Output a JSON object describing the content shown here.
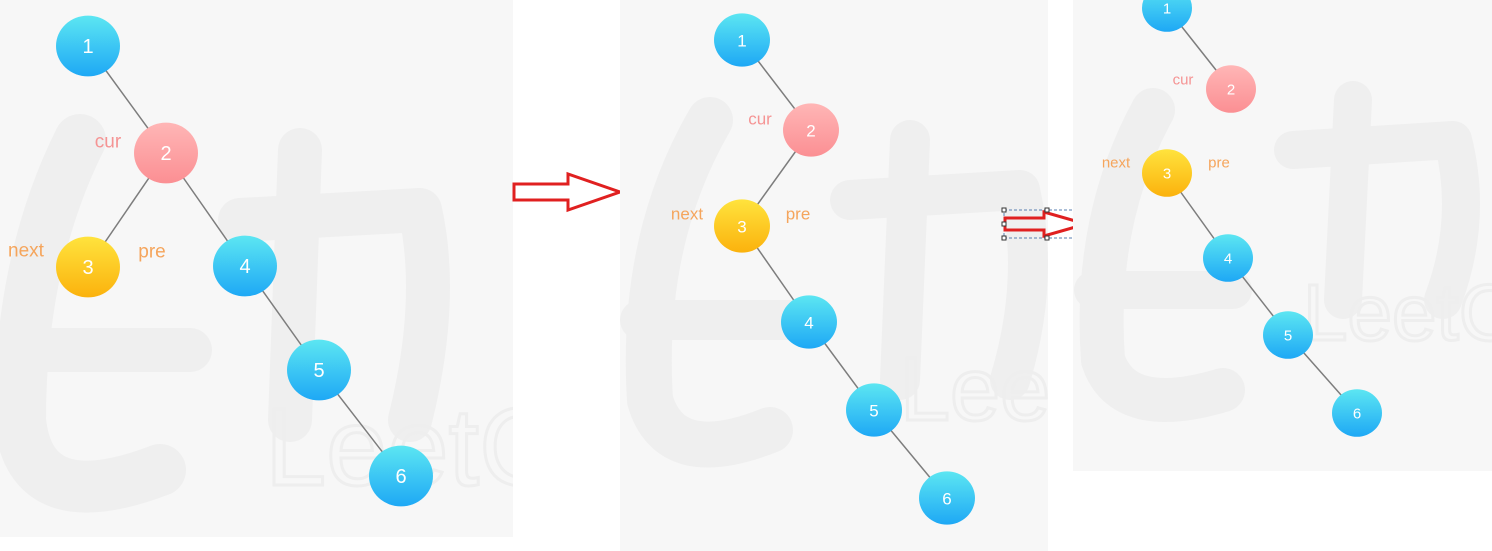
{
  "colors": {
    "blue_top": "#5ce6f2",
    "blue_bottom": "#1ea8f5",
    "pink_top": "#ffb6b6",
    "pink_bottom": "#fb8f93",
    "yellow_top": "#ffe33d",
    "yellow_bottom": "#fbb20d",
    "edge": "#7d7d7d",
    "cur_text": "#f59494",
    "pointer_text": "#f5a55c",
    "arrow": "#e02020"
  },
  "panels": [
    {
      "nodes": [
        {
          "id": "1",
          "label": "1",
          "role": "plain"
        },
        {
          "id": "2",
          "label": "2",
          "role": "cur"
        },
        {
          "id": "3",
          "label": "3",
          "role": "next"
        },
        {
          "id": "4",
          "label": "4",
          "role": "plain"
        },
        {
          "id": "5",
          "label": "5",
          "role": "plain"
        },
        {
          "id": "6",
          "label": "6",
          "role": "plain"
        }
      ],
      "edges": [
        [
          "1",
          "2"
        ],
        [
          "2",
          "3"
        ],
        [
          "2",
          "4"
        ],
        [
          "4",
          "5"
        ],
        [
          "5",
          "6"
        ]
      ],
      "pointers": [
        {
          "text": "cur",
          "node": "2"
        },
        {
          "text": "next",
          "node": "3"
        },
        {
          "text": "pre",
          "node": "3"
        }
      ]
    },
    {
      "nodes": [
        {
          "id": "1",
          "label": "1",
          "role": "plain"
        },
        {
          "id": "2",
          "label": "2",
          "role": "cur"
        },
        {
          "id": "3",
          "label": "3",
          "role": "next"
        },
        {
          "id": "4",
          "label": "4",
          "role": "plain"
        },
        {
          "id": "5",
          "label": "5",
          "role": "plain"
        },
        {
          "id": "6",
          "label": "6",
          "role": "plain"
        }
      ],
      "edges": [
        [
          "1",
          "2"
        ],
        [
          "2",
          "3"
        ],
        [
          "3",
          "4"
        ],
        [
          "4",
          "5"
        ],
        [
          "5",
          "6"
        ]
      ],
      "pointers": [
        {
          "text": "cur",
          "node": "2"
        },
        {
          "text": "next",
          "node": "3"
        },
        {
          "text": "pre",
          "node": "3"
        }
      ]
    },
    {
      "nodes": [
        {
          "id": "1",
          "label": "1",
          "role": "plain"
        },
        {
          "id": "2",
          "label": "2",
          "role": "cur"
        },
        {
          "id": "3",
          "label": "3",
          "role": "next"
        },
        {
          "id": "4",
          "label": "4",
          "role": "plain"
        },
        {
          "id": "5",
          "label": "5",
          "role": "plain"
        },
        {
          "id": "6",
          "label": "6",
          "role": "plain"
        }
      ],
      "edges": [
        [
          "1",
          "2"
        ],
        [
          "3",
          "4"
        ],
        [
          "4",
          "5"
        ],
        [
          "5",
          "6"
        ]
      ],
      "pointers": [
        {
          "text": "cur",
          "node": "2"
        },
        {
          "text": "next",
          "node": "3"
        },
        {
          "text": "pre",
          "node": "3"
        }
      ]
    }
  ],
  "watermark_text": "LeetC"
}
